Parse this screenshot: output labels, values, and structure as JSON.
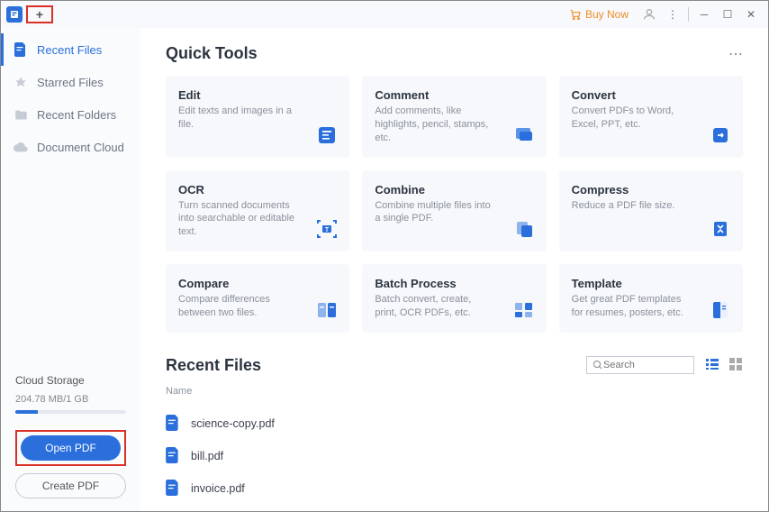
{
  "titlebar": {
    "buy_now": "Buy Now"
  },
  "sidebar": {
    "items": [
      {
        "label": "Recent Files"
      },
      {
        "label": "Starred Files"
      },
      {
        "label": "Recent Folders"
      },
      {
        "label": "Document Cloud"
      }
    ],
    "cloud": {
      "title": "Cloud Storage",
      "usage": "204.78 MB/1 GB"
    },
    "open_pdf": "Open PDF",
    "create_pdf": "Create PDF"
  },
  "quick_tools": {
    "title": "Quick Tools",
    "cards": [
      {
        "title": "Edit",
        "desc": "Edit texts and images in a file."
      },
      {
        "title": "Comment",
        "desc": "Add comments, like highlights, pencil, stamps, etc."
      },
      {
        "title": "Convert",
        "desc": "Convert PDFs to Word, Excel, PPT, etc."
      },
      {
        "title": "OCR",
        "desc": "Turn scanned documents into searchable or editable text."
      },
      {
        "title": "Combine",
        "desc": "Combine multiple files into a single PDF."
      },
      {
        "title": "Compress",
        "desc": "Reduce a PDF file size."
      },
      {
        "title": "Compare",
        "desc": "Compare differences between two files."
      },
      {
        "title": "Batch Process",
        "desc": "Batch convert, create, print, OCR PDFs, etc."
      },
      {
        "title": "Template",
        "desc": "Get great PDF templates for resumes, posters, etc."
      }
    ]
  },
  "recent": {
    "title": "Recent Files",
    "col_name": "Name",
    "search_placeholder": "Search",
    "files": [
      {
        "name": "science-copy.pdf"
      },
      {
        "name": "bill.pdf"
      },
      {
        "name": "invoice.pdf"
      }
    ]
  }
}
